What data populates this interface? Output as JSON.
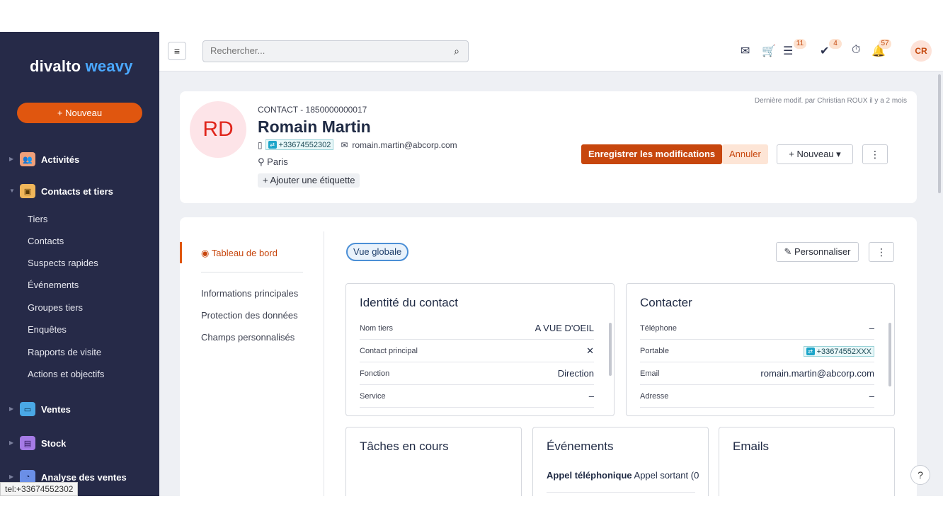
{
  "sidebar": {
    "logo_part1": "divalto",
    "logo_part2": "weavy",
    "new_button": "+ Nouveau",
    "sections": [
      {
        "label": "Activités",
        "icon": "people-icon",
        "color": "#f0a07a"
      },
      {
        "label": "Contacts et tiers",
        "icon": "contact-card-icon",
        "color": "#f0b65a"
      },
      {
        "label": "Ventes",
        "icon": "cash-icon",
        "color": "#4aa8e6"
      },
      {
        "label": "Stock",
        "icon": "box-icon",
        "color": "#a57be6"
      },
      {
        "label": "Analyse des ventes",
        "icon": "chart-icon",
        "color": "#6b8fe6"
      }
    ],
    "contact_items": [
      "Tiers",
      "Contacts",
      "Suspects rapides",
      "Événements",
      "Groupes tiers",
      "Enquêtes",
      "Rapports de visite",
      "Actions et objectifs"
    ]
  },
  "status_url": "tel:+33674552302",
  "topbar": {
    "search_placeholder": "Rechercher...",
    "badges": {
      "tasks": "11",
      "checks": "4",
      "notifications": "57"
    },
    "user_initials": "CR"
  },
  "header": {
    "avatar_initials": "RD",
    "code": "CONTACT - 1850000000017",
    "name": "Romain Martin",
    "phone": "+33674552302",
    "email": "romain.martin@abcorp.com",
    "city": "Paris",
    "add_tag": "+ Ajouter une étiquette",
    "last_modified": "Dernière modif. par Christian ROUX il y a 2 mois",
    "save_label": "Enregistrer les modifications",
    "cancel_label": "Annuler",
    "new_label": "+ Nouveau ▾",
    "more_label": "⋮"
  },
  "left_nav": {
    "active": "Tableau de bord",
    "links": [
      "Informations principales",
      "Protection des données",
      "Champs personnalisés"
    ]
  },
  "dashboard": {
    "view_pill": "Vue globale",
    "customize_label": "Personnaliser",
    "more_label": "⋮",
    "identity": {
      "title": "Identité du contact",
      "rows": [
        {
          "label": "Nom tiers",
          "value": "A VUE D'OEIL"
        },
        {
          "label": "Contact principal",
          "value": "✕"
        },
        {
          "label": "Fonction",
          "value": "Direction"
        },
        {
          "label": "Service",
          "value": "–"
        }
      ]
    },
    "contact": {
      "title": "Contacter",
      "rows": [
        {
          "label": "Téléphone",
          "value": "–"
        },
        {
          "label": "Portable",
          "value": "+33674552XXX"
        },
        {
          "label": "Email",
          "value": "romain.martin@abcorp.com"
        },
        {
          "label": "Adresse",
          "value": "–"
        }
      ]
    },
    "tasks": {
      "title": "Tâches en cours"
    },
    "events": {
      "title": "Événements",
      "item_bold": "Appel téléphonique",
      "item_rest": "Appel sortant (0"
    },
    "emails": {
      "title": "Emails"
    }
  },
  "help_label": "?"
}
